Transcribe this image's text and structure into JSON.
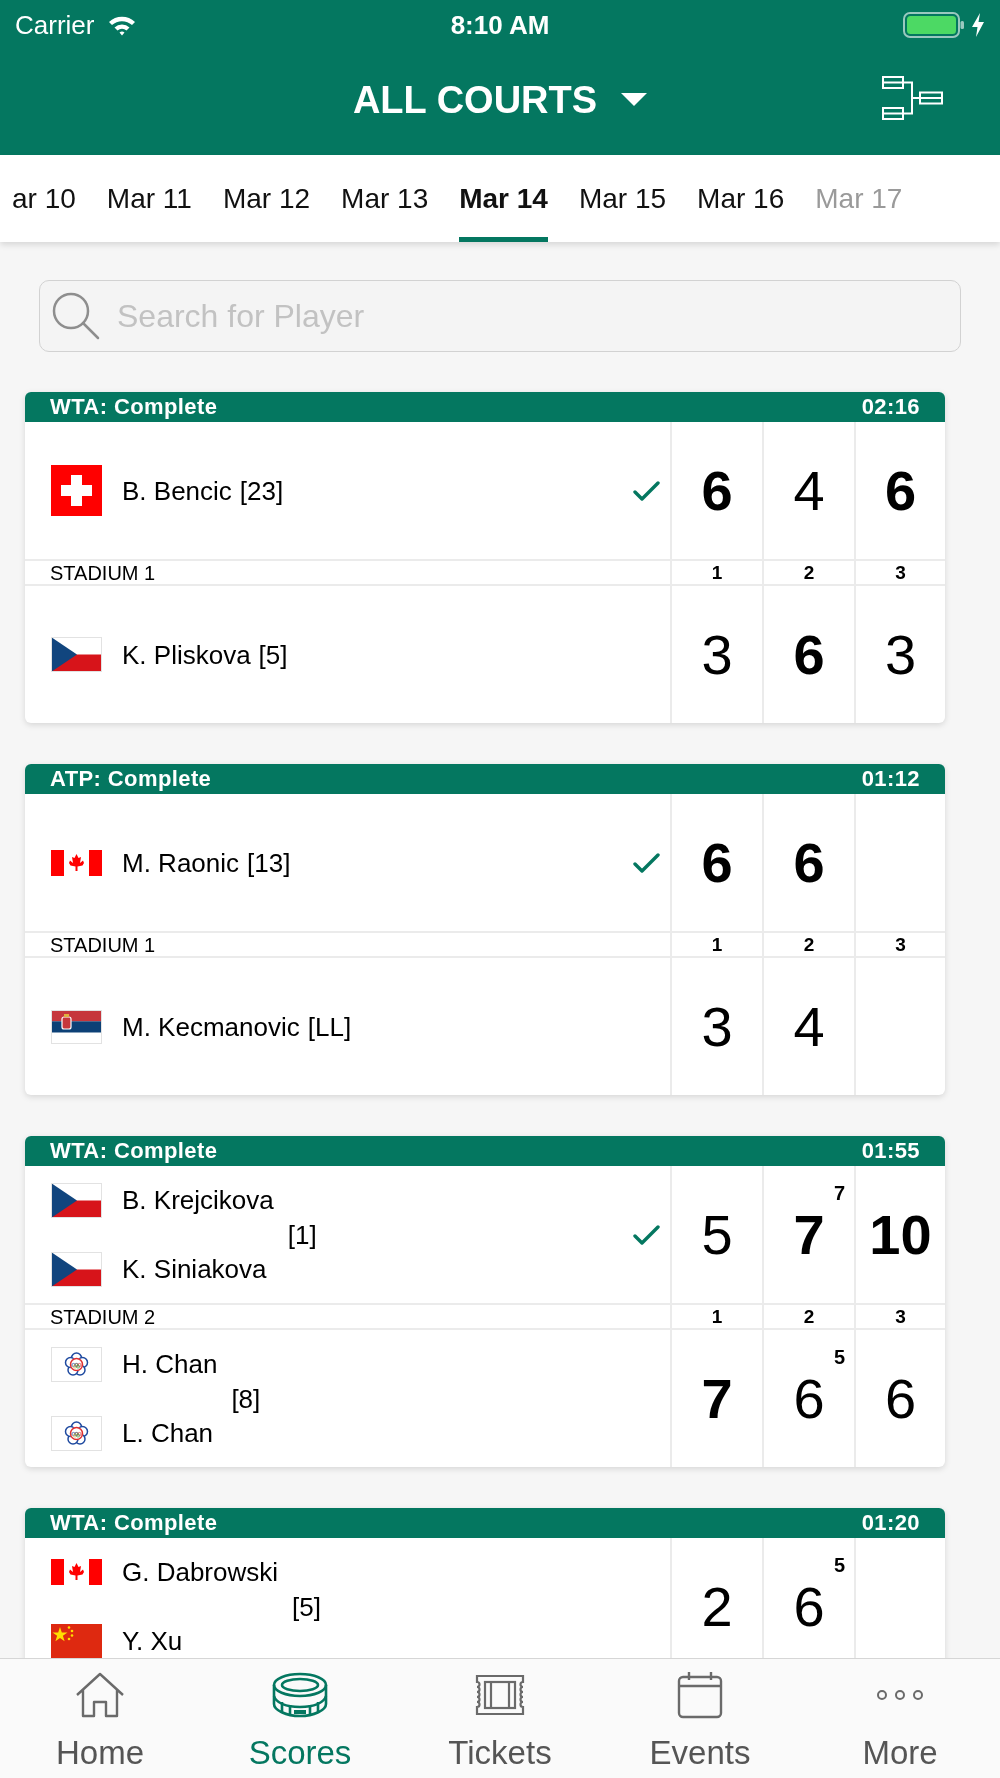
{
  "status_bar": {
    "carrier": "Carrier",
    "time": "8:10 AM"
  },
  "header": {
    "title": "ALL COURTS"
  },
  "dates": [
    {
      "label": "ar 10",
      "selected": false,
      "disabled": false
    },
    {
      "label": "Mar 11",
      "selected": false,
      "disabled": false
    },
    {
      "label": "Mar 12",
      "selected": false,
      "disabled": false
    },
    {
      "label": "Mar 13",
      "selected": false,
      "disabled": false
    },
    {
      "label": "Mar 14",
      "selected": true,
      "disabled": false
    },
    {
      "label": "Mar 15",
      "selected": false,
      "disabled": false
    },
    {
      "label": "Mar 16",
      "selected": false,
      "disabled": false
    },
    {
      "label": "Mar 17",
      "selected": false,
      "disabled": true
    }
  ],
  "search": {
    "placeholder": "Search for Player"
  },
  "matches": [
    {
      "title": "WTA: Complete",
      "duration": "02:16",
      "court": "STADIUM 1",
      "set_labels": [
        "1",
        "2",
        "3"
      ],
      "teams": [
        {
          "players": [
            {
              "name": "B. Bencic",
              "kind": "switzerland"
            }
          ],
          "seed": "[23]",
          "winner": true,
          "sets": [
            {
              "games": "6",
              "won": true
            },
            {
              "games": "4",
              "won": false
            },
            {
              "games": "6",
              "won": true
            }
          ]
        },
        {
          "players": [
            {
              "name": "K. Pliskova",
              "kind": "czech"
            }
          ],
          "seed": "[5]",
          "winner": false,
          "sets": [
            {
              "games": "3",
              "won": false
            },
            {
              "games": "6",
              "won": true
            },
            {
              "games": "3",
              "won": false
            }
          ]
        }
      ]
    },
    {
      "title": "ATP: Complete",
      "duration": "01:12",
      "court": "STADIUM 1",
      "set_labels": [
        "1",
        "2",
        "3"
      ],
      "teams": [
        {
          "players": [
            {
              "name": "M. Raonic",
              "kind": "canada"
            }
          ],
          "seed": "[13]",
          "winner": true,
          "sets": [
            {
              "games": "6",
              "won": true
            },
            {
              "games": "6",
              "won": true
            }
          ]
        },
        {
          "players": [
            {
              "name": "M. Kecmanovic",
              "kind": "serbia"
            }
          ],
          "seed": "[LL]",
          "winner": false,
          "sets": [
            {
              "games": "3",
              "won": false
            },
            {
              "games": "4",
              "won": false
            }
          ]
        }
      ]
    },
    {
      "title": "WTA: Complete",
      "duration": "01:55",
      "court": "STADIUM 2",
      "set_labels": [
        "1",
        "2",
        "3"
      ],
      "teams": [
        {
          "players": [
            {
              "name": "B. Krejcikova",
              "kind": "czech"
            },
            {
              "name": "K. Siniakova",
              "kind": "czech"
            }
          ],
          "seed": "[1]",
          "winner": true,
          "sets": [
            {
              "games": "5",
              "won": false
            },
            {
              "games": "7",
              "won": true,
              "tiebreak": "7"
            },
            {
              "games": "10",
              "won": true
            }
          ]
        },
        {
          "players": [
            {
              "name": "H. Chan",
              "kind": "taipei"
            },
            {
              "name": "L. Chan",
              "kind": "taipei"
            }
          ],
          "seed": "[8]",
          "winner": false,
          "sets": [
            {
              "games": "7",
              "won": true
            },
            {
              "games": "6",
              "won": false,
              "tiebreak": "5"
            },
            {
              "games": "6",
              "won": false
            }
          ]
        }
      ]
    },
    {
      "title": "WTA: Complete",
      "duration": "01:20",
      "teams": [
        {
          "players": [
            {
              "name": "G. Dabrowski",
              "kind": "canada"
            },
            {
              "name": "Y. Xu",
              "kind": "china"
            }
          ],
          "seed": "[5]",
          "winner": false,
          "sets": [
            {
              "games": "2",
              "won": false
            },
            {
              "games": "6",
              "won": false,
              "tiebreak": "5"
            }
          ]
        }
      ]
    }
  ],
  "nav": [
    {
      "label": "Home",
      "kind": "home",
      "selected": false
    },
    {
      "label": "Scores",
      "kind": "scores",
      "selected": true
    },
    {
      "label": "Tickets",
      "kind": "tickets",
      "selected": false
    },
    {
      "label": "Events",
      "kind": "events",
      "selected": false
    },
    {
      "label": "More",
      "kind": "more",
      "selected": false
    }
  ]
}
